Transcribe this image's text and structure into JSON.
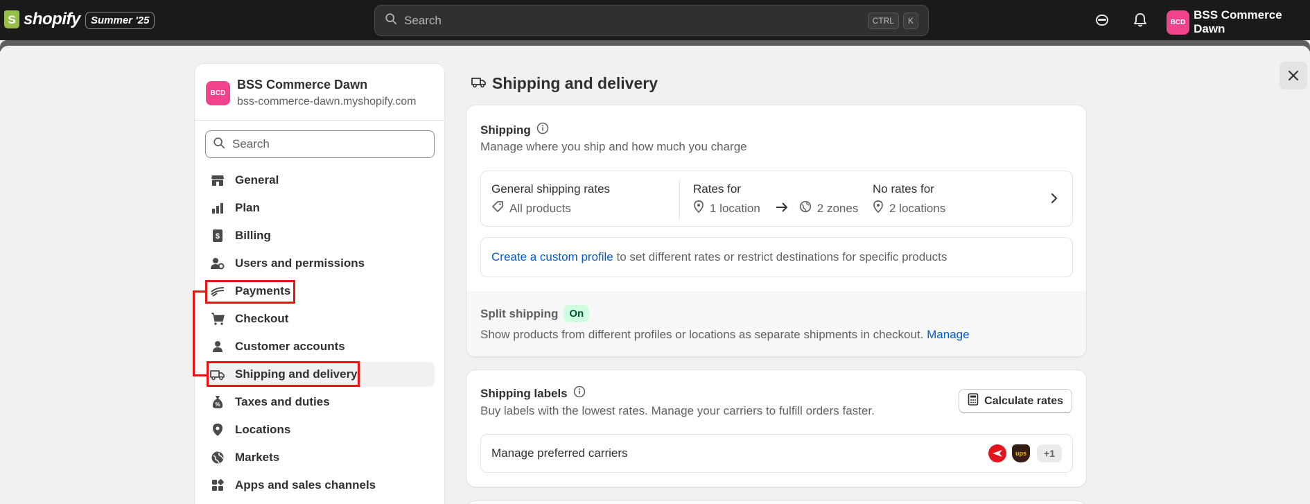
{
  "topbar": {
    "logo_word": "shopify",
    "edition_badge": "Summer '25",
    "search_placeholder": "Search",
    "shortcut_keys": [
      "CTRL",
      "K"
    ],
    "avatar_initials": "BCD",
    "account_name": "BSS Commerce Dawn"
  },
  "sidebar": {
    "store_initials": "BCD",
    "store_name": "BSS Commerce Dawn",
    "store_url": "bss-commerce-dawn.myshopify.com",
    "search_placeholder": "Search",
    "items": [
      {
        "label": "General",
        "icon": "store-icon"
      },
      {
        "label": "Plan",
        "icon": "plan-icon"
      },
      {
        "label": "Billing",
        "icon": "billing-icon"
      },
      {
        "label": "Users and permissions",
        "icon": "users-icon"
      },
      {
        "label": "Payments",
        "icon": "payments-icon"
      },
      {
        "label": "Checkout",
        "icon": "cart-icon"
      },
      {
        "label": "Customer accounts",
        "icon": "person-icon"
      },
      {
        "label": "Shipping and delivery",
        "icon": "truck-icon",
        "active": true
      },
      {
        "label": "Taxes and duties",
        "icon": "taxes-icon"
      },
      {
        "label": "Locations",
        "icon": "location-icon"
      },
      {
        "label": "Markets",
        "icon": "globe-icon"
      },
      {
        "label": "Apps and sales channels",
        "icon": "apps-icon"
      }
    ]
  },
  "main": {
    "page_title": "Shipping and delivery",
    "shipping": {
      "title": "Shipping",
      "subtitle": "Manage where you ship and how much you charge",
      "general_rates": {
        "heading": "General shipping rates",
        "products": "All products",
        "rates_for_heading": "Rates for",
        "rates_location": "1 location",
        "rates_zones": "2 zones",
        "no_rates_heading": "No rates for",
        "no_rates_locations": "2 locations"
      },
      "custom_profile_link": "Create a custom profile",
      "custom_profile_text": " to set different rates or restrict destinations for specific products",
      "split_title": "Split shipping",
      "split_status": "On",
      "split_text": "Show products from different profiles or locations as separate shipments in checkout. ",
      "split_manage_link": "Manage"
    },
    "labels": {
      "title": "Shipping labels",
      "subtitle": "Buy labels with the lowest rates. Manage your carriers to fulfill orders faster.",
      "calc_button": "Calculate rates",
      "carriers_label": "Manage preferred carriers",
      "ups_text": "ups",
      "more_carriers": "+1"
    }
  },
  "colors": {
    "topbar_bg": "#1a1a1a",
    "brand_avatar": "#f0438b",
    "link": "#005bd3",
    "on_badge_bg": "#cdfee1",
    "annotation_red": "#e11111"
  }
}
